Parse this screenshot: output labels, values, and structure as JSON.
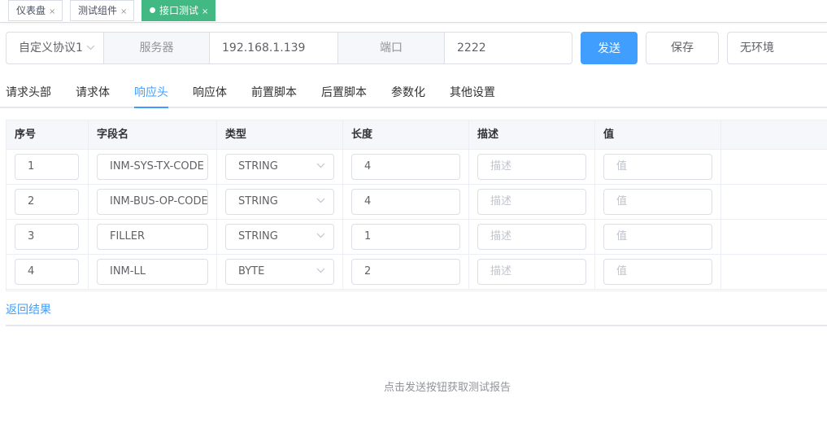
{
  "tabs": [
    {
      "label": "仪表盘",
      "close": "×"
    },
    {
      "label": "测试组件",
      "close": "×"
    },
    {
      "label": "接口测试",
      "close": "×"
    }
  ],
  "request": {
    "protocol": "自定义协议1",
    "server_label": "服务器",
    "server_value": "192.168.1.139",
    "port_label": "端口",
    "port_value": "2222",
    "send_label": "发送",
    "save_label": "保存",
    "env_value": "无环境"
  },
  "subtabs": [
    "请求头部",
    "请求体",
    "响应头",
    "响应体",
    "前置脚本",
    "后置脚本",
    "参数化",
    "其他设置"
  ],
  "active_subtab": "响应头",
  "table": {
    "headers": [
      "序号",
      "字段名",
      "类型",
      "长度",
      "描述",
      "值"
    ],
    "desc_placeholder": "描述",
    "value_placeholder": "值",
    "rows": [
      {
        "seq": "1",
        "field": "INM-SYS-TX-CODE",
        "type": "STRING",
        "length": "4"
      },
      {
        "seq": "2",
        "field": "INM-BUS-OP-CODE",
        "type": "STRING",
        "length": "4"
      },
      {
        "seq": "3",
        "field": "FILLER",
        "type": "STRING",
        "length": "1"
      },
      {
        "seq": "4",
        "field": "INM-LL",
        "type": "BYTE",
        "length": "2"
      }
    ]
  },
  "result": {
    "tab_label": "返回结果",
    "empty_message": "点击发送按钮获取测试报告"
  },
  "colors": {
    "primary": "#409eff",
    "active_tab": "#42b983"
  }
}
